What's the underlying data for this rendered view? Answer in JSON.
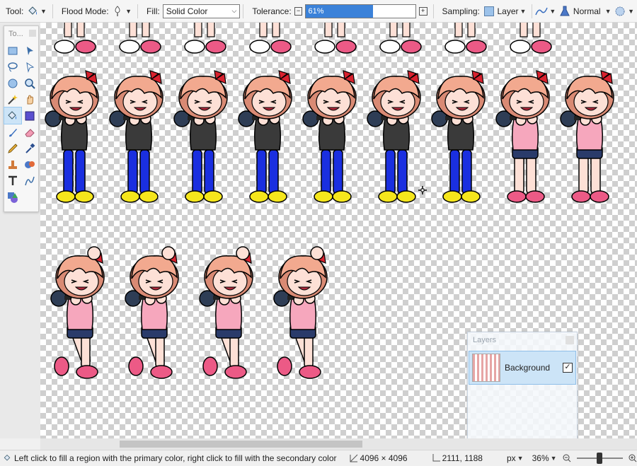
{
  "toolbar": {
    "tool_label": "Tool:",
    "tool_icon": "paint-bucket-icon",
    "flood_mode_label": "Flood Mode:",
    "fill_label": "Fill:",
    "fill_value": "Solid Color",
    "tolerance_label": "Tolerance:",
    "tolerance_value": "61%",
    "tolerance_fraction": 0.61,
    "sampling_label": "Sampling:",
    "sampling_value": "Layer",
    "blend_value": "Normal",
    "accent": "#3b82d9"
  },
  "tools_panel": {
    "title": "To...",
    "tools": [
      "rectangle-select-icon",
      "move-selection-icon",
      "lasso-select-icon",
      "move-pixels-icon",
      "ellipse-select-icon",
      "zoom-icon",
      "magic-wand-icon",
      "pan-icon",
      "paint-bucket-icon",
      "gradient-icon",
      "paintbrush-icon",
      "eraser-icon",
      "pencil-icon",
      "color-picker-icon",
      "clone-stamp-icon",
      "recolor-icon",
      "text-icon",
      "line-curve-icon",
      "shapes-icon"
    ]
  },
  "layers_panel": {
    "title": "Layers",
    "layers": [
      {
        "name": "Background",
        "visible": true
      }
    ]
  },
  "status": {
    "hint": "Left click to fill a region with the primary color, right click to fill with the secondary color",
    "image_size": "4096 × 4096",
    "cursor_pos": "2111, 1188",
    "unit": "px",
    "zoom": "36%"
  },
  "colors": {
    "hair": "#f2a98f",
    "hair_shade": "#d98a74",
    "skin": "#fde0d6",
    "bow": "#d9222f",
    "black_top": "#3a3a3a",
    "pink_top": "#f6a7bd",
    "blue_jeans": "#1a2fe0",
    "dark_shorts": "#2a3b6a",
    "yellow_shoe": "#f5e61c",
    "pink_shoe": "#ec5a86",
    "mic": "#2e3d55"
  }
}
